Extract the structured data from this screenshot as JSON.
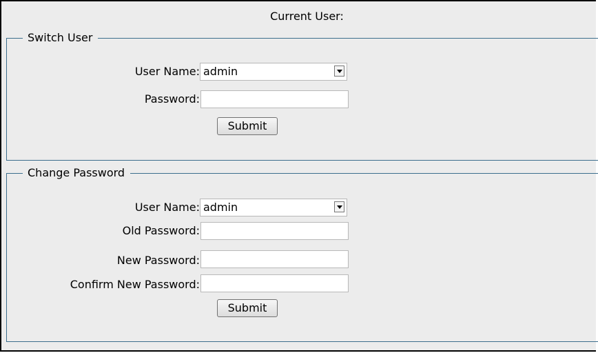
{
  "header": {
    "current_user_label": "Current User:"
  },
  "switch_user": {
    "legend": "Switch User",
    "username_label": "User Name:",
    "username_value": "admin",
    "password_label": "Password:",
    "submit_label": "Submit"
  },
  "change_password": {
    "legend": "Change Password",
    "username_label": "User Name:",
    "username_value": "admin",
    "old_password_label": "Old Password:",
    "new_password_label": "New Password:",
    "confirm_password_label": "Confirm New Password:",
    "submit_label": "Submit"
  }
}
